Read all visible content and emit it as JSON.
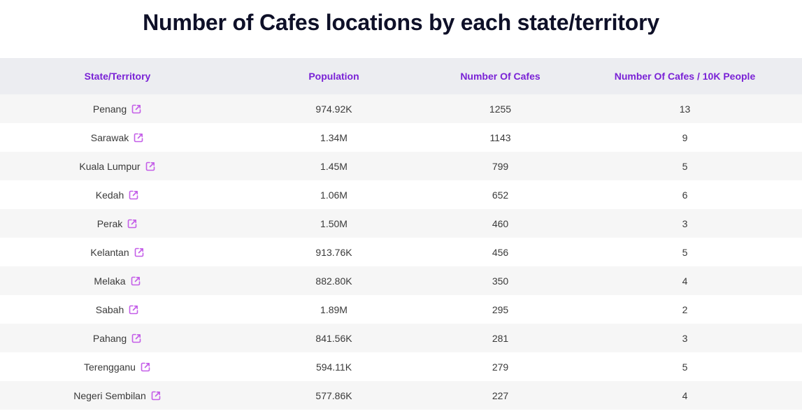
{
  "page": {
    "title": "Number of Cafes locations by each state/territory"
  },
  "table": {
    "headers": [
      "State/Territory",
      "Population",
      "Number Of Cafes",
      "Number Of Cafes / 10K People"
    ],
    "link_icon": "external-link-icon",
    "rows": [
      {
        "state": "Penang",
        "population": "974.92K",
        "cafes": "1255",
        "per10k": "13"
      },
      {
        "state": "Sarawak",
        "population": "1.34M",
        "cafes": "1143",
        "per10k": "9"
      },
      {
        "state": "Kuala Lumpur",
        "population": "1.45M",
        "cafes": "799",
        "per10k": "5"
      },
      {
        "state": "Kedah",
        "population": "1.06M",
        "cafes": "652",
        "per10k": "6"
      },
      {
        "state": "Perak",
        "population": "1.50M",
        "cafes": "460",
        "per10k": "3"
      },
      {
        "state": "Kelantan",
        "population": "913.76K",
        "cafes": "456",
        "per10k": "5"
      },
      {
        "state": "Melaka",
        "population": "882.80K",
        "cafes": "350",
        "per10k": "4"
      },
      {
        "state": "Sabah",
        "population": "1.89M",
        "cafes": "295",
        "per10k": "2"
      },
      {
        "state": "Pahang",
        "population": "841.56K",
        "cafes": "281",
        "per10k": "3"
      },
      {
        "state": "Terengganu",
        "population": "594.11K",
        "cafes": "279",
        "per10k": "5"
      },
      {
        "state": "Negeri Sembilan",
        "population": "577.86K",
        "cafes": "227",
        "per10k": "4"
      }
    ]
  },
  "colors": {
    "header_text": "#7a22d6",
    "icon": "#c45ee8",
    "title": "#0e1028"
  }
}
